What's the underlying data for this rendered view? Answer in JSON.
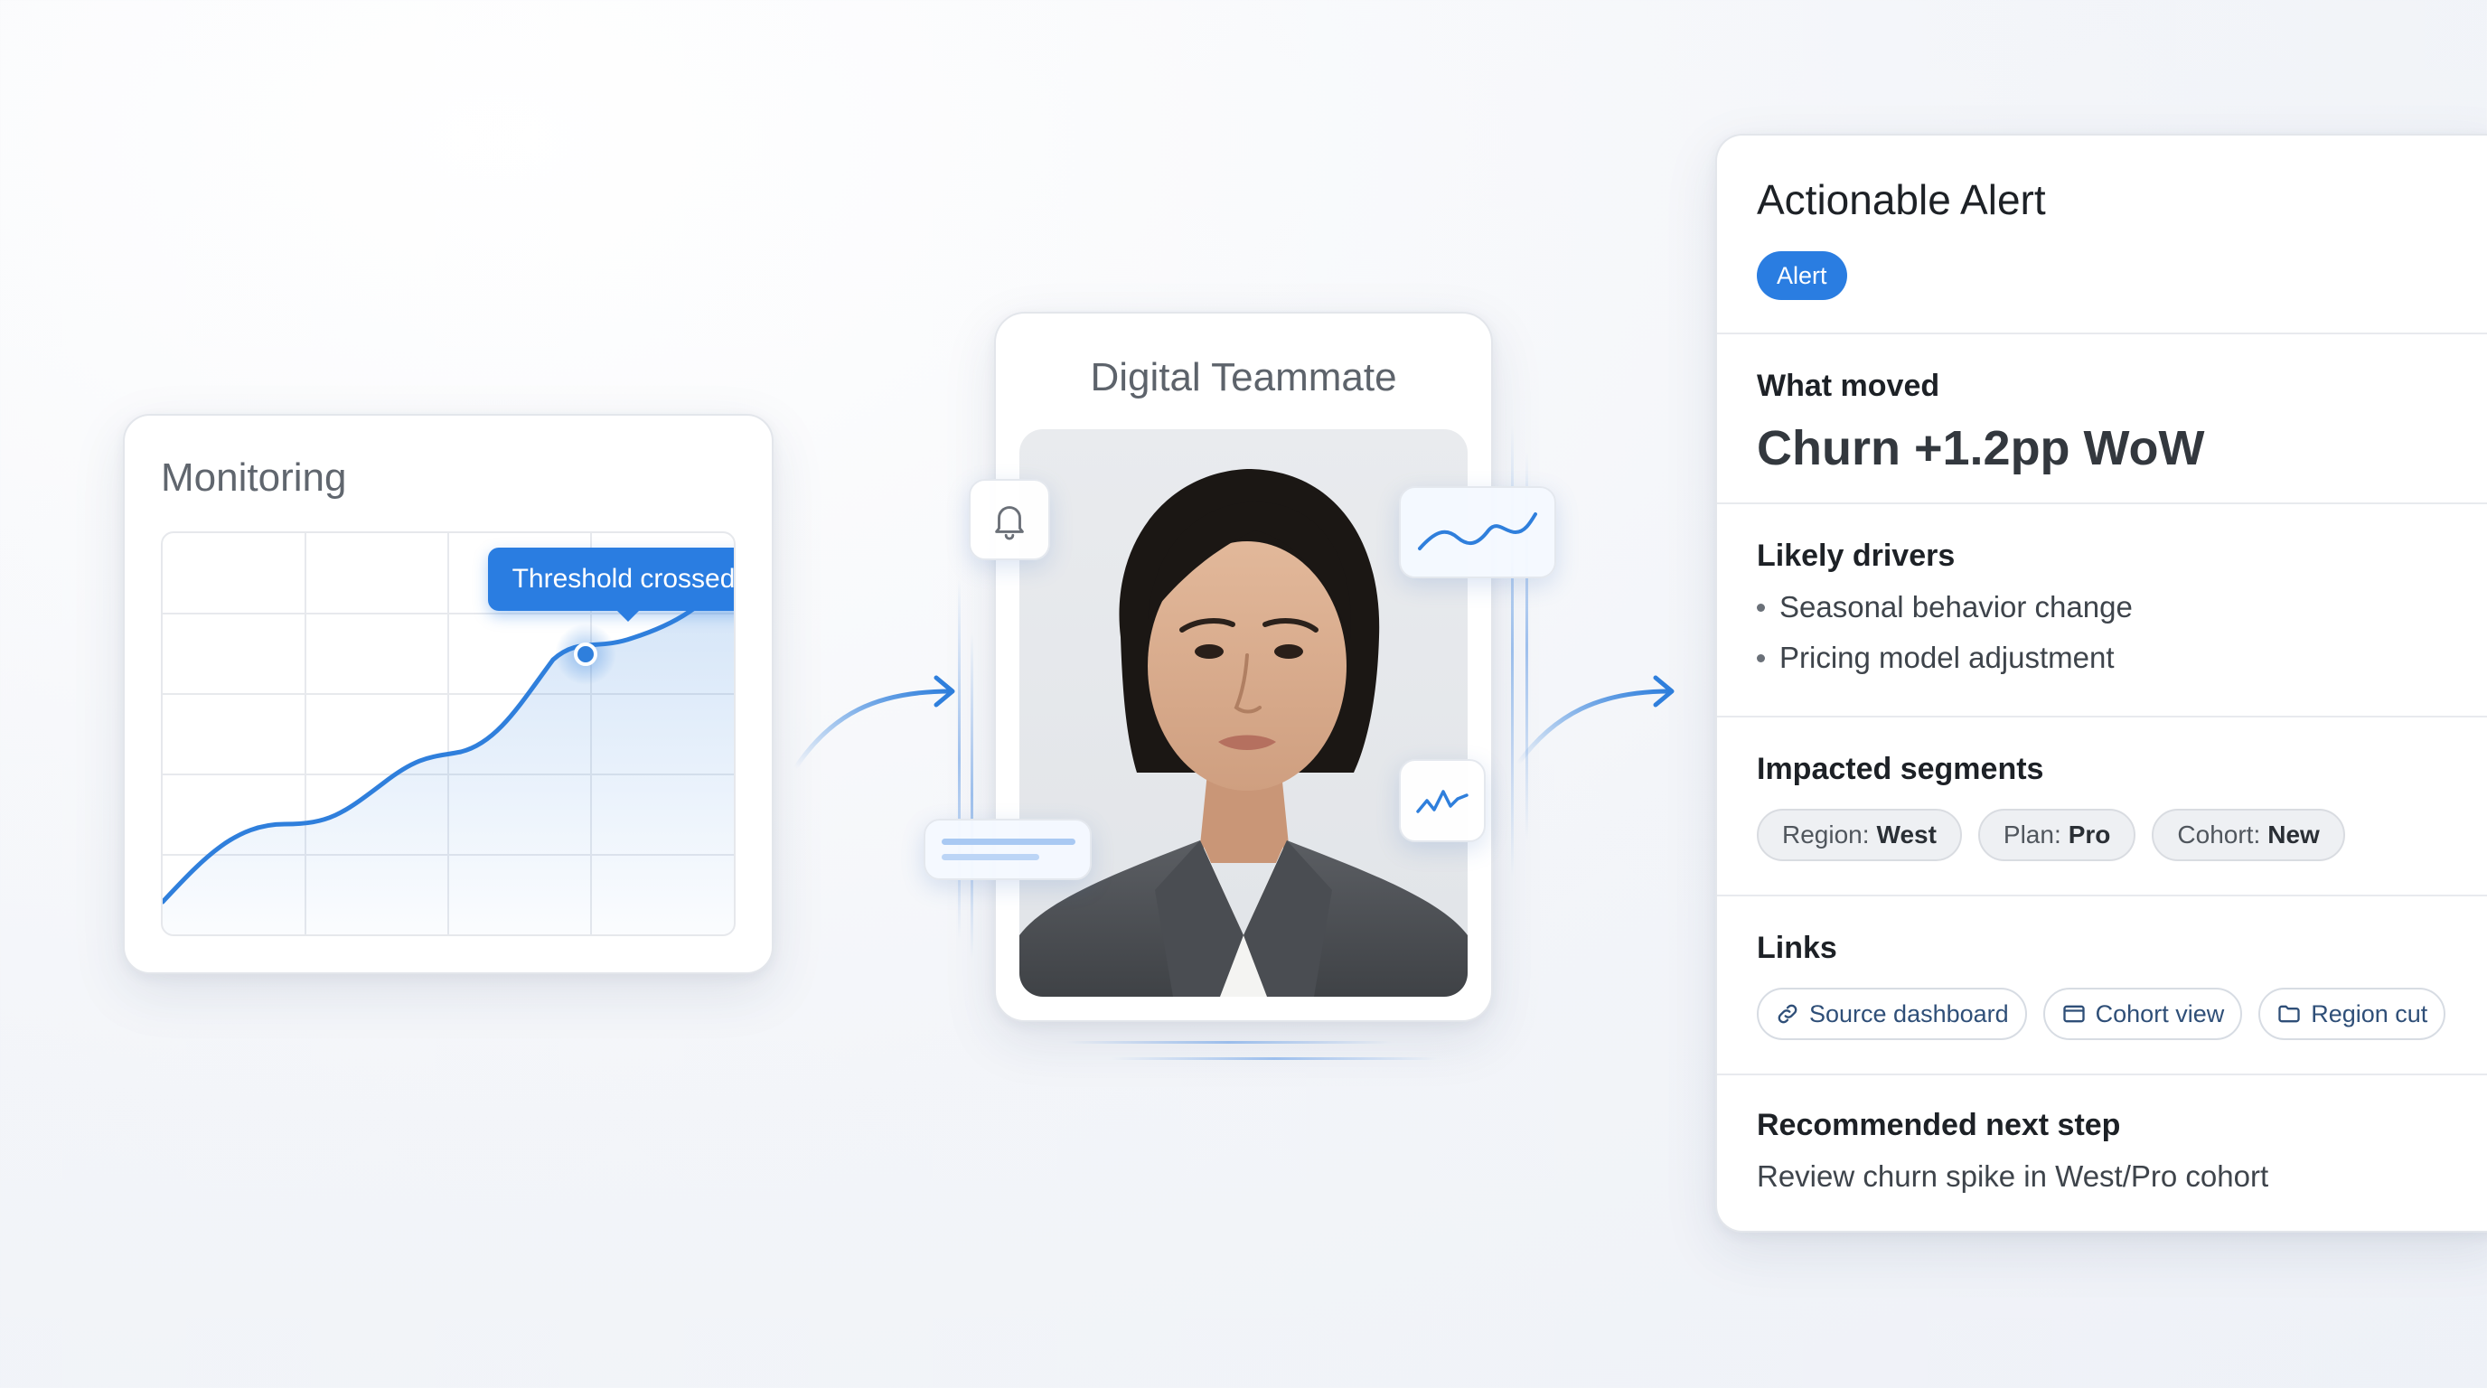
{
  "monitoring": {
    "title": "Monitoring",
    "tooltip": "Threshold crossed"
  },
  "teammate": {
    "title": "Digital Teammate"
  },
  "alert": {
    "title": "Actionable Alert",
    "badge": "Alert",
    "what_moved": {
      "label": "What moved",
      "value": "Churn +1.2pp WoW"
    },
    "likely_drivers": {
      "label": "Likely drivers",
      "items": [
        "Seasonal behavior change",
        "Pricing model adjustment"
      ]
    },
    "impacted_segments": {
      "label": "Impacted segments",
      "chips": [
        {
          "key": "Region:",
          "value": "West"
        },
        {
          "key": "Plan:",
          "value": "Pro"
        },
        {
          "key": "Cohort:",
          "value": "New"
        }
      ]
    },
    "links": {
      "label": "Links",
      "items": [
        {
          "label": "Source dashboard",
          "icon": "link-icon"
        },
        {
          "label": "Cohort view",
          "icon": "window-icon"
        },
        {
          "label": "Region cut",
          "icon": "folder-icon"
        }
      ]
    },
    "next_step": {
      "label": "Recommended next step",
      "text": "Review churn spike in West/Pro cohort"
    }
  },
  "colors": {
    "accent": "#2a7de1",
    "chart_line": "#2f7fdc",
    "text_dark": "#1d2126",
    "text_muted": "#5d636b"
  }
}
